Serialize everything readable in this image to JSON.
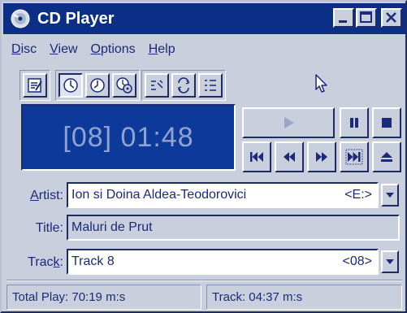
{
  "window": {
    "title": "CD Player",
    "colors": {
      "titlebar": "#0b2e86",
      "body": "#c9cfdc",
      "text": "#1b2a79",
      "lcd": "#0d3a9a",
      "lcd_text": "#8fa3cf"
    }
  },
  "menu": [
    {
      "name": "menu-disc",
      "first": "D",
      "rest": "isc"
    },
    {
      "name": "menu-view",
      "first": "V",
      "rest": "iew"
    },
    {
      "name": "menu-options",
      "first": "O",
      "rest": "ptions"
    },
    {
      "name": "menu-help",
      "first": "H",
      "rest": "elp"
    }
  ],
  "display": {
    "text": "[08] 01:48"
  },
  "fields": {
    "artist": {
      "label_u": "A",
      "label_rest": "rtist:",
      "value": "Ion si Doina Aldea-Teodorovici",
      "drive": "<E:>"
    },
    "title": {
      "label": "Title:",
      "value": "Maluri de Prut"
    },
    "track": {
      "label_first": "Trac",
      "label_u": "k",
      "label_rest": ":",
      "value": "Track 8",
      "number": "<08>"
    }
  },
  "status": {
    "total_play": "Total Play: 70:19 m:s",
    "track": "Track: 04:37 m:s"
  },
  "icons": {
    "toolbar": [
      "edit-playlist-icon",
      "track-time-elapsed-icon",
      "track-time-remaining-icon",
      "disc-time-remaining-icon",
      "random-order-icon",
      "continuous-play-icon",
      "intro-play-icon"
    ],
    "transport": [
      "play-icon",
      "pause-icon",
      "stop-icon",
      "previous-track-icon",
      "skip-backwards-icon",
      "skip-forwards-icon",
      "next-track-icon",
      "eject-icon"
    ]
  }
}
